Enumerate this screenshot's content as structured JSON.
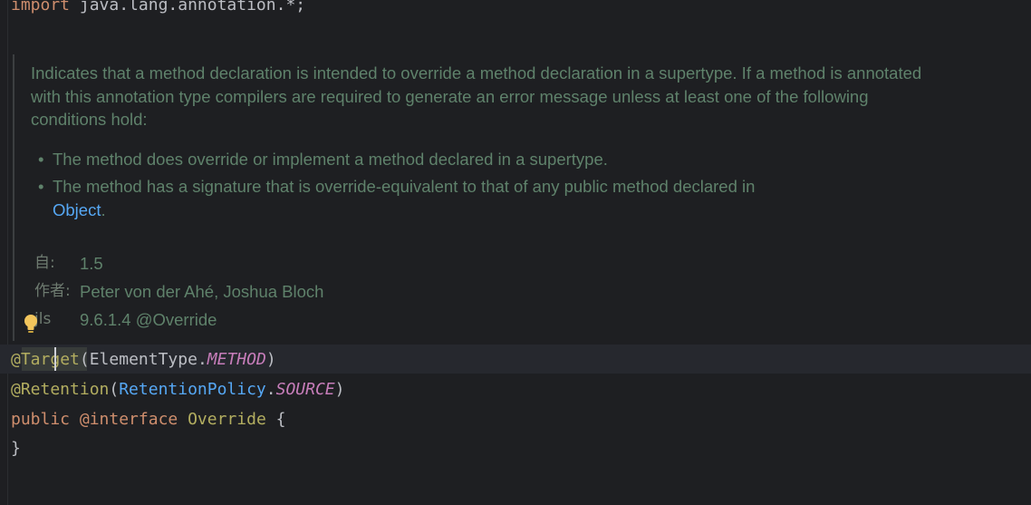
{
  "editor": {
    "import_line": {
      "keyword": "import",
      "path": " java.lang.annotation.*;"
    },
    "doc": {
      "paragraph": "Indicates that a method declaration is intended to override a method declaration in a supertype. If a method is annotated with this annotation type compilers are required to generate an error message unless at least one of the following conditions hold:",
      "bullets": [
        "The method does override or implement a method declared in a supertype.",
        "The method has a signature that is override-equivalent to that of any public method declared in"
      ],
      "bullet_link": "Object",
      "bullet_link_suffix": ".",
      "bullet_marker": "•",
      "tags": [
        {
          "label": "自:",
          "value": "1.5"
        },
        {
          "label": "作者:",
          "value": "Peter von der Ahé, Joshua Bloch"
        },
        {
          "label": "jls",
          "value": "9.6.1.4 @Override"
        }
      ]
    },
    "code_lines": {
      "line1": {
        "at_target_a": "@Ta",
        "at_target_b": "rget",
        "open": "(",
        "type": "ElementType",
        "dot": ".",
        "constant": "METHOD",
        "close": ")"
      },
      "line2": {
        "annotation": "@Retention",
        "open": "(",
        "type": "RetentionPolicy",
        "dot": ".",
        "constant": "SOURCE",
        "close": ")"
      },
      "line3": {
        "public": "public",
        "interface": "@interface",
        "name": "Override",
        "brace": "{"
      },
      "line4": {
        "brace": "}"
      }
    },
    "colors": {
      "background": "#1e1f22",
      "keyword": "#cf8e6d",
      "annotation": "#b3ae60",
      "reference": "#56a8f5",
      "constant": "#c77dba",
      "doc_text": "#5f826b"
    },
    "icons": {
      "intention_bulb": "lightbulb-icon"
    }
  }
}
